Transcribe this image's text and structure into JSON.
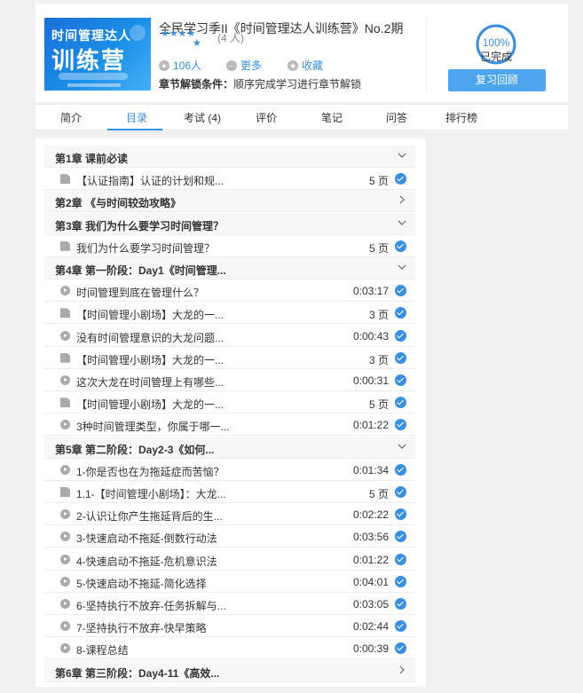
{
  "course": {
    "title": "全民学习季II《时间管理达人训练营》No.2期",
    "cover_line1": "时间管理达人",
    "cover_line2": "训练营",
    "rating_count": "(4 人)",
    "learners": "106人",
    "more_label": "更多",
    "favorite_label": "收藏",
    "unlock_label": "章节解锁条件：",
    "unlock_value": "顺序完成学习进行章节解锁",
    "progress": 100,
    "progress_text": "100%",
    "progress_status": "已完成",
    "review_button": "复习回顾"
  },
  "tabs": [
    {
      "label": "简介"
    },
    {
      "label": "目录"
    },
    {
      "label": "考试 (4)"
    },
    {
      "label": "评价"
    },
    {
      "label": "笔记"
    },
    {
      "label": "问答"
    },
    {
      "label": "排行榜"
    }
  ],
  "active_tab": "目录",
  "rows": [
    {
      "kind": "chapter",
      "title": "第1章 课前必读",
      "expanded": true
    },
    {
      "kind": "item",
      "icon": "doc-icon",
      "title": "【认证指南】认证的计划和规...",
      "meta": "5 页",
      "done": true
    },
    {
      "kind": "chapter",
      "title": "第2章 《与时间较劲攻略》",
      "expanded": false
    },
    {
      "kind": "chapter",
      "title": "第3章 我们为什么要学习时间管理？",
      "expanded": true
    },
    {
      "kind": "item",
      "icon": "doc-icon",
      "title": "我们为什么要学习时间管理？",
      "meta": "5 页",
      "done": true
    },
    {
      "kind": "chapter",
      "title": "第4章 第一阶段：Day1《时间管理...",
      "expanded": true
    },
    {
      "kind": "item",
      "icon": "video-icon",
      "title": "时间管理到底在管理什么？",
      "meta": "0:03:17",
      "done": true
    },
    {
      "kind": "item",
      "icon": "doc-icon",
      "title": "【时间管理小剧场】大龙的一...",
      "meta": "3 页",
      "done": true
    },
    {
      "kind": "item",
      "icon": "video-icon",
      "title": "没有时间管理意识的大龙问题...",
      "meta": "0:00:43",
      "done": true
    },
    {
      "kind": "item",
      "icon": "doc-icon",
      "title": "【时间管理小剧场】大龙的一...",
      "meta": "3 页",
      "done": true
    },
    {
      "kind": "item",
      "icon": "video-icon",
      "title": "这次大龙在时间管理上有哪些...",
      "meta": "0:00:31",
      "done": true
    },
    {
      "kind": "item",
      "icon": "doc-icon",
      "title": "【时间管理小剧场】大龙的一...",
      "meta": "5 页",
      "done": true
    },
    {
      "kind": "item",
      "icon": "video-icon",
      "title": "3种时间管理类型，你属于哪一...",
      "meta": "0:01:22",
      "done": true
    },
    {
      "kind": "chapter",
      "title": "第5章 第二阶段：Day2-3《如何...",
      "expanded": true
    },
    {
      "kind": "item",
      "icon": "video-icon",
      "title": "1-你是否也在为拖延症而苦恼？",
      "meta": "0:01:34",
      "done": true
    },
    {
      "kind": "item",
      "icon": "doc-icon",
      "title": "1.1-【时间管理小剧场】：大龙...",
      "meta": "5 页",
      "done": true
    },
    {
      "kind": "item",
      "icon": "video-icon",
      "title": "2-认识让你产生拖延背后的生...",
      "meta": "0:02:22",
      "done": true
    },
    {
      "kind": "item",
      "icon": "video-icon",
      "title": "3-快速启动不拖延-倒数行动法",
      "meta": "0:03:56",
      "done": true
    },
    {
      "kind": "item",
      "icon": "video-icon",
      "title": "4-快速启动不拖延-危机意识法",
      "meta": "0:01:22",
      "done": true
    },
    {
      "kind": "item",
      "icon": "video-icon",
      "title": "5-快速启动不拖延-简化选择",
      "meta": "0:04:01",
      "done": true
    },
    {
      "kind": "item",
      "icon": "video-icon",
      "title": "6-坚持执行不放弃-任务拆解与...",
      "meta": "0:03:05",
      "done": true
    },
    {
      "kind": "item",
      "icon": "video-icon",
      "title": "7-坚持执行不放弃-快早策略",
      "meta": "0:02:44",
      "done": true
    },
    {
      "kind": "item",
      "icon": "video-icon",
      "title": "8-课程总结",
      "meta": "0:00:39",
      "done": true
    },
    {
      "kind": "chapter",
      "title": "第6章 第三阶段：Day4-11《高效...",
      "expanded": false
    }
  ],
  "colors": {
    "accent": "#3b8fe0",
    "button": "#4da5ef"
  }
}
